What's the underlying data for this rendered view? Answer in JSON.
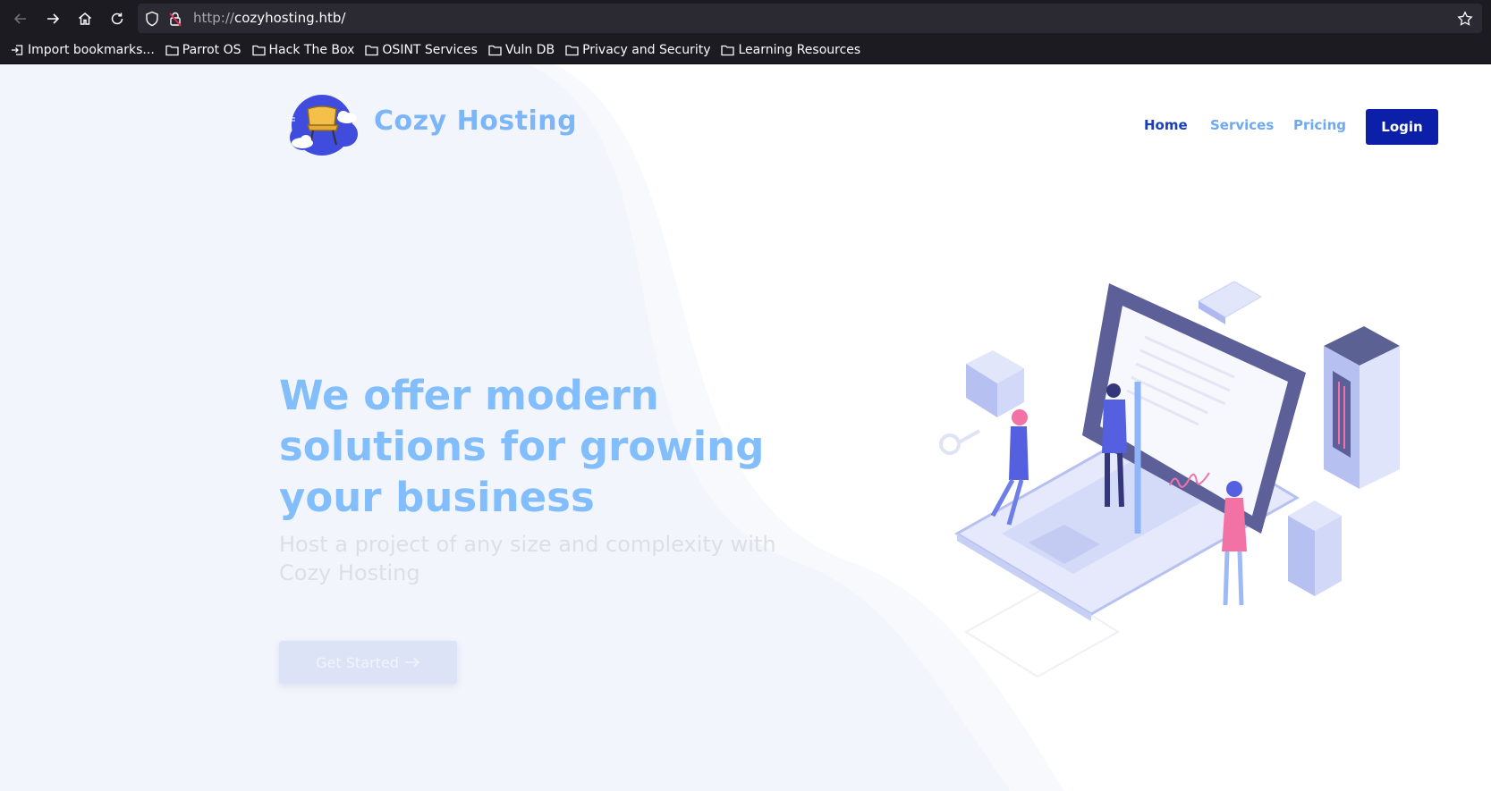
{
  "browser": {
    "url_protocol": "http://",
    "url_host": "cozyhosting.htb/",
    "bookmarks": [
      {
        "label": "Import bookmarks...",
        "icon": "import-icon"
      },
      {
        "label": "Parrot OS",
        "icon": "folder-icon"
      },
      {
        "label": "Hack The Box",
        "icon": "folder-icon"
      },
      {
        "label": "OSINT Services",
        "icon": "folder-icon"
      },
      {
        "label": "Vuln DB",
        "icon": "folder-icon"
      },
      {
        "label": "Privacy and Security",
        "icon": "folder-icon"
      },
      {
        "label": "Learning Resources",
        "icon": "folder-icon"
      }
    ]
  },
  "header": {
    "brand": "Cozy Hosting",
    "nav": {
      "home": "Home",
      "services": "Services",
      "pricing": "Pricing",
      "login": "Login"
    }
  },
  "hero": {
    "title": "We offer modern solutions for growing your business",
    "subtitle": "Host a project of any size and complexity with Cozy Hosting",
    "cta": "Get Started"
  },
  "colors": {
    "accent": "#0c1fa8",
    "brand_text": "#7cb6f8",
    "nav_active": "#1a3fb8",
    "nav_link": "#6fa9f0"
  }
}
